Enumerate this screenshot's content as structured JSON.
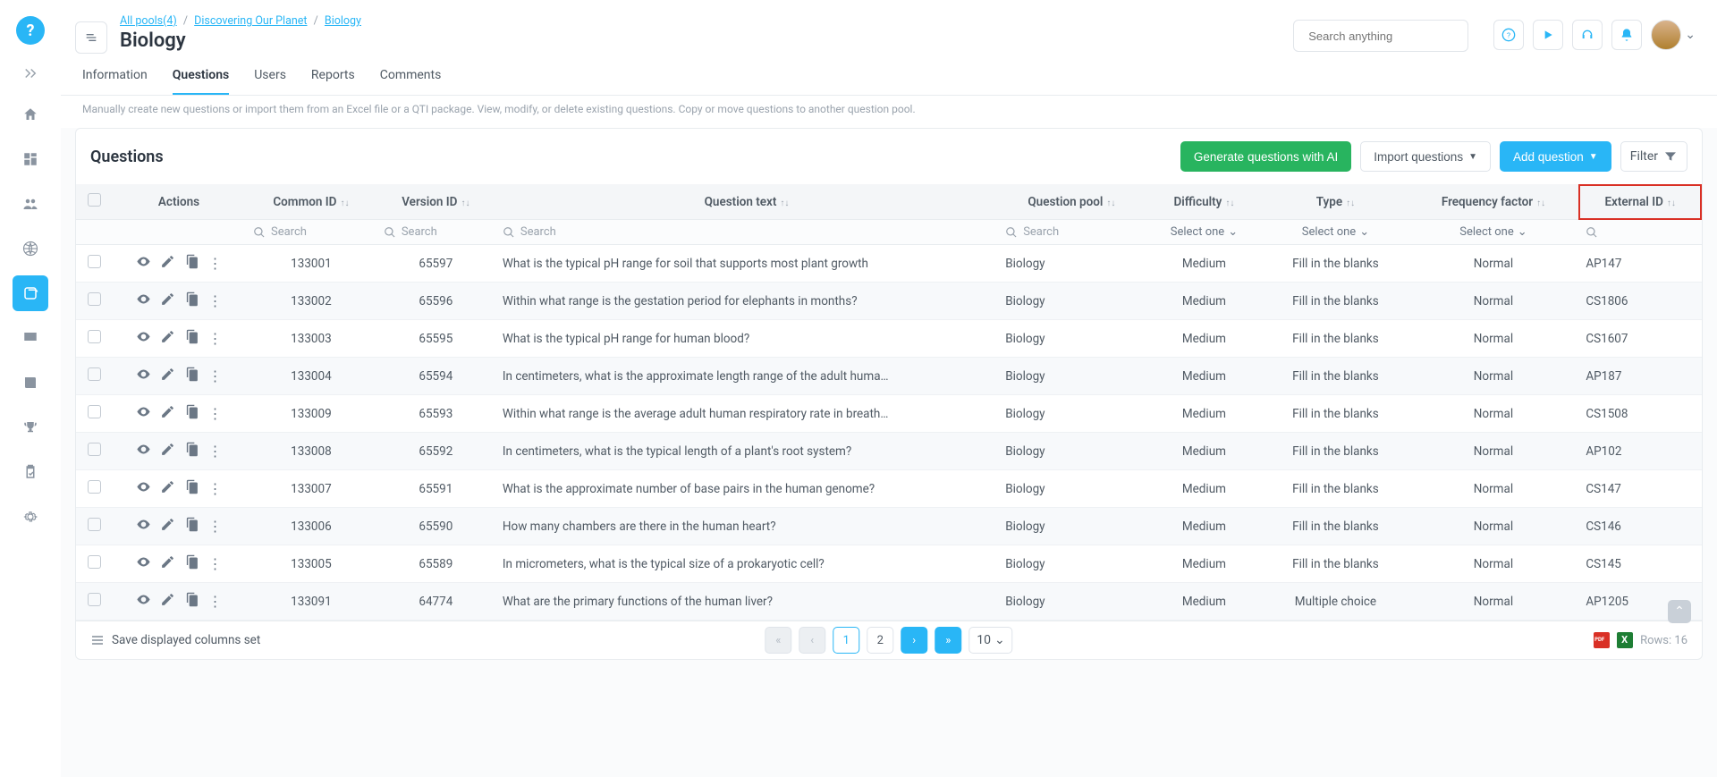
{
  "breadcrumbs": [
    {
      "label": "All pools(4)"
    },
    {
      "label": "Discovering Our Planet"
    },
    {
      "label": "Biology"
    }
  ],
  "page_title": "Biology",
  "search_placeholder": "Search anything",
  "tabs": [
    {
      "label": "Information",
      "active": false
    },
    {
      "label": "Questions",
      "active": true
    },
    {
      "label": "Users",
      "active": false
    },
    {
      "label": "Reports",
      "active": false
    },
    {
      "label": "Comments",
      "active": false
    }
  ],
  "subtext": "Manually create new questions or import them from an Excel file or a QTI package. View, modify, or delete existing questions. Copy or move questions to another question pool.",
  "card_title": "Questions",
  "buttons": {
    "generate_ai": "Generate questions with AI",
    "import": "Import questions",
    "add": "Add question",
    "filter": "Filter"
  },
  "columns": {
    "actions": "Actions",
    "common_id": "Common ID",
    "version_id": "Version ID",
    "question_text": "Question text",
    "question_pool": "Question pool",
    "difficulty": "Difficulty",
    "type": "Type",
    "frequency": "Frequency factor",
    "external_id": "External ID"
  },
  "filter_labels": {
    "search": "Search",
    "select_one": "Select one"
  },
  "rows": [
    {
      "common_id": "133001",
      "version_id": "65597",
      "text": "What is the typical pH range for soil that supports most plant growth",
      "pool": "Biology",
      "difficulty": "Medium",
      "type": "Fill in the blanks",
      "freq": "Normal",
      "ext": "AP147"
    },
    {
      "common_id": "133002",
      "version_id": "65596",
      "text": "Within what range is the gestation period for elephants in months?",
      "pool": "Biology",
      "difficulty": "Medium",
      "type": "Fill in the blanks",
      "freq": "Normal",
      "ext": "CS1806"
    },
    {
      "common_id": "133003",
      "version_id": "65595",
      "text": "What is the typical pH range for human blood?",
      "pool": "Biology",
      "difficulty": "Medium",
      "type": "Fill in the blanks",
      "freq": "Normal",
      "ext": "CS1607"
    },
    {
      "common_id": "133004",
      "version_id": "65594",
      "text": "In centimeters, what is the approximate length range of the adult huma…",
      "pool": "Biology",
      "difficulty": "Medium",
      "type": "Fill in the blanks",
      "freq": "Normal",
      "ext": "AP187"
    },
    {
      "common_id": "133009",
      "version_id": "65593",
      "text": "Within what range is the average adult human respiratory rate in breath…",
      "pool": "Biology",
      "difficulty": "Medium",
      "type": "Fill in the blanks",
      "freq": "Normal",
      "ext": "CS1508"
    },
    {
      "common_id": "133008",
      "version_id": "65592",
      "text": "In centimeters, what is the typical length of a plant's root system?",
      "pool": "Biology",
      "difficulty": "Medium",
      "type": "Fill in the blanks",
      "freq": "Normal",
      "ext": "AP102"
    },
    {
      "common_id": "133007",
      "version_id": "65591",
      "text": "What is the approximate number of base pairs in the human genome?",
      "pool": "Biology",
      "difficulty": "Medium",
      "type": "Fill in the blanks",
      "freq": "Normal",
      "ext": "CS147"
    },
    {
      "common_id": "133006",
      "version_id": "65590",
      "text": "How many chambers are there in the human heart?",
      "pool": "Biology",
      "difficulty": "Medium",
      "type": "Fill in the blanks",
      "freq": "Normal",
      "ext": "CS146"
    },
    {
      "common_id": "133005",
      "version_id": "65589",
      "text": "In micrometers, what is the typical size of a prokaryotic cell?",
      "pool": "Biology",
      "difficulty": "Medium",
      "type": "Fill in the blanks",
      "freq": "Normal",
      "ext": "CS145"
    },
    {
      "common_id": "133091",
      "version_id": "64774",
      "text": "What are the primary functions of the human liver?",
      "pool": "Biology",
      "difficulty": "Medium",
      "type": "Multiple choice",
      "freq": "Normal",
      "ext": "AP1205"
    }
  ],
  "footer": {
    "save_cols": "Save displayed columns set",
    "pages": [
      "1",
      "2"
    ],
    "page_size": "10",
    "rows_label": "Rows: 16"
  }
}
